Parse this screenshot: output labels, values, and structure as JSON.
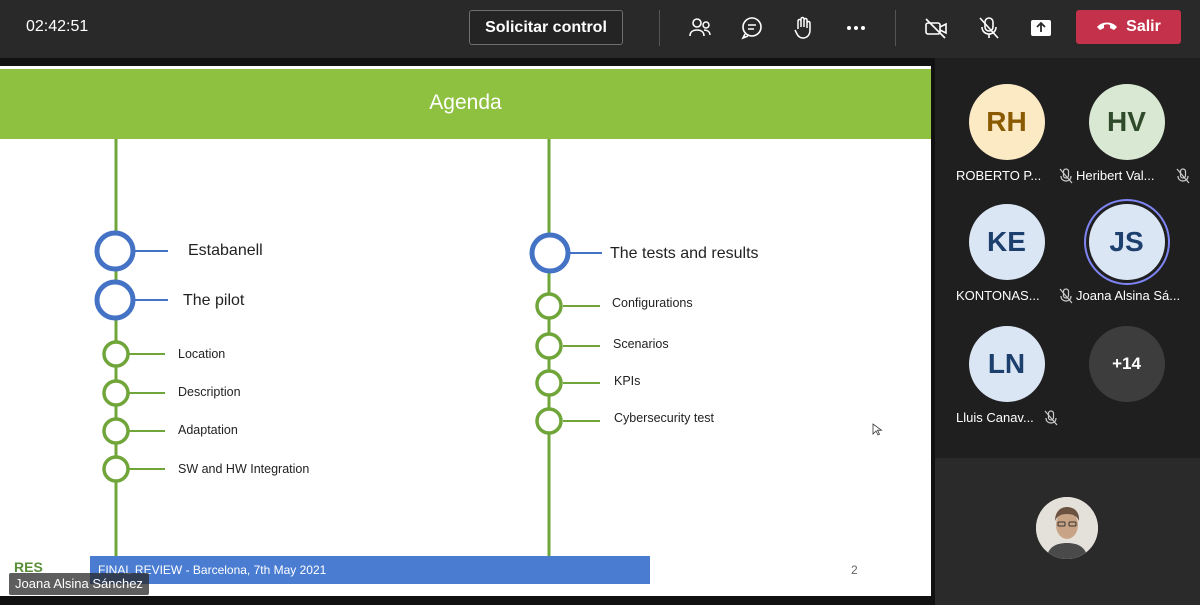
{
  "toolbar": {
    "timer": "02:42:51",
    "request_control": "Solicitar control",
    "leave": "Salir",
    "icons": [
      "people-icon",
      "chat-icon",
      "raise-hand-icon",
      "more-icon",
      "camera-off-icon",
      "mic-off-icon",
      "share-icon",
      "phone-hangup-icon"
    ],
    "leave_color": "#c4314b"
  },
  "slide": {
    "title": "Agenda",
    "header_color": "#8dc13f",
    "left_items": [
      "Estabanell",
      "The pilot",
      "Location",
      "Description",
      "Adaptation",
      "SW and HW Integration"
    ],
    "right_items": [
      "The tests and results",
      "Configurations",
      "Scenarios",
      "KPIs",
      "Cybersecurity test"
    ],
    "footer": "FINAL REVIEW - Barcelona, 7th May 2021",
    "page": "2",
    "logo": "RES",
    "presenter": "Joana Alsina Sánchez"
  },
  "participants": [
    {
      "initials": "RH",
      "name": "ROBERTO P...",
      "bg": "#fbeac4",
      "fg": "#8a5a00",
      "muted": true
    },
    {
      "initials": "HV",
      "name": "Heribert Val...",
      "bg": "#d9e8d3",
      "fg": "#2f4a2a",
      "muted": true
    },
    {
      "initials": "KE",
      "name": "KONTONAS...",
      "bg": "#dbe6f5",
      "fg": "#1d3f6e",
      "muted": true
    },
    {
      "initials": "JS",
      "name": "Joana Alsina Sá...",
      "bg": "#dbe6f5",
      "fg": "#1d3f6e",
      "muted": false
    },
    {
      "initials": "LN",
      "name": "Lluis Canav...",
      "bg": "#dbe6f5",
      "fg": "#1d3f6e",
      "muted": true
    },
    {
      "initials": "+14",
      "name": "",
      "bg": "#3d3d3d",
      "fg": "#ffffff",
      "muted": false
    }
  ]
}
